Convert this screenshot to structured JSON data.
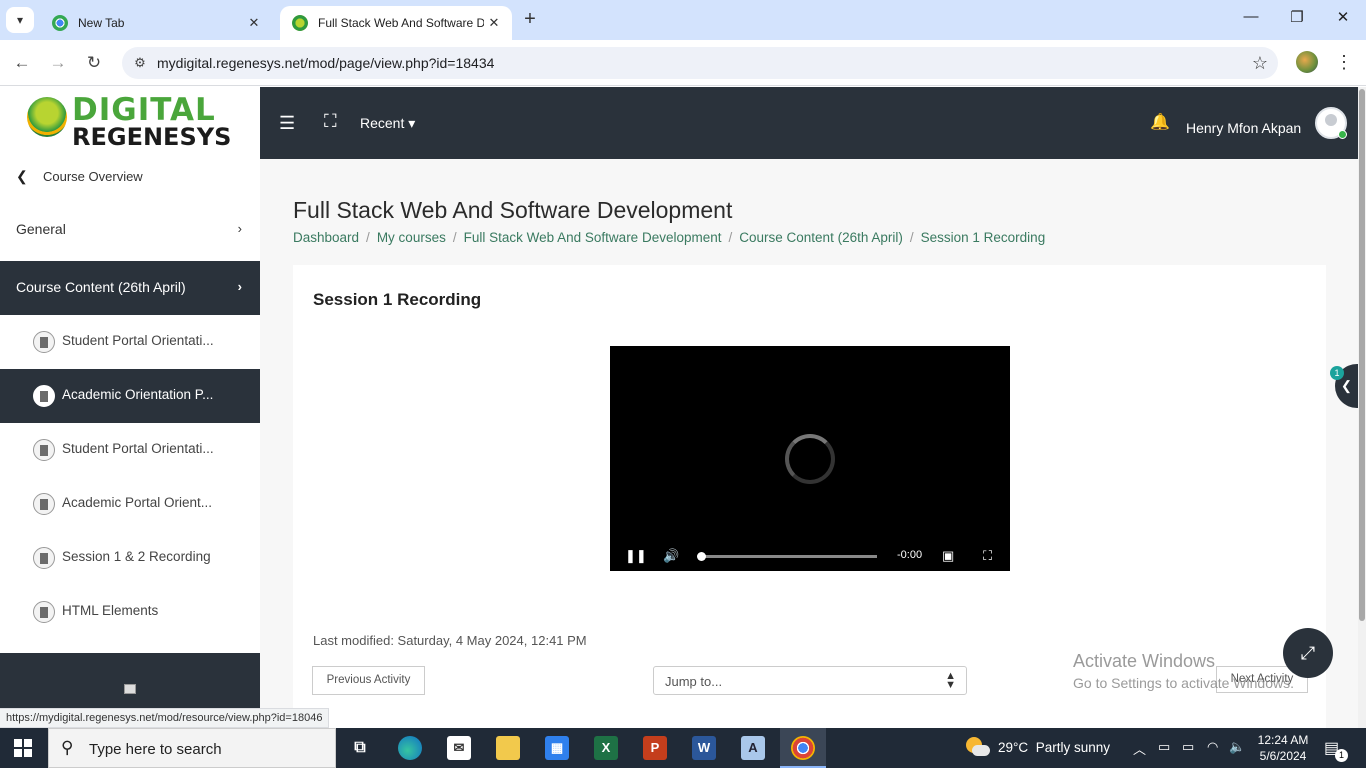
{
  "browser": {
    "tabs": [
      {
        "title": "New Tab",
        "active": false
      },
      {
        "title": "Full Stack Web And Software De",
        "active": true
      }
    ],
    "url": "mydigital.regenesys.net/mod/page/view.php?id=18434",
    "status_link": "https://mydigital.regenesys.net/mod/resource/view.php?id=18046"
  },
  "brand": {
    "logo_line1": "DIGITAL",
    "logo_line2": "REGENESYS",
    "accent": "#4aa63b",
    "nav_bg": "#2a323b"
  },
  "header": {
    "recent_label": "Recent",
    "user_name": "Henry Mfon Akpan"
  },
  "sidebar": {
    "back_label": "Course Overview",
    "sections": [
      {
        "label": "General"
      },
      {
        "label": "Course Content (26th April)"
      }
    ],
    "items": [
      {
        "label": "Student Portal Orientati...",
        "icon": "document-icon",
        "active": false
      },
      {
        "label": "Academic Orientation P...",
        "icon": "document-icon",
        "active": true
      },
      {
        "label": "Student Portal Orientati...",
        "icon": "document-icon",
        "active": false
      },
      {
        "label": "Academic Portal Orient...",
        "icon": "document-icon",
        "active": false
      },
      {
        "label": "Session 1 & 2 Recording",
        "icon": "document-icon",
        "active": false
      },
      {
        "label": "HTML Elements",
        "icon": "book-icon",
        "active": false
      }
    ]
  },
  "main": {
    "page_title": "Full Stack Web And Software Development",
    "breadcrumb": [
      "Dashboard",
      "My courses",
      "Full Stack Web And Software Development",
      "Course Content (26th April)",
      "Session 1 Recording"
    ],
    "card_title": "Session 1 Recording",
    "video": {
      "time": "-0:00",
      "progress": 0
    },
    "last_modified": "Last modified: Saturday, 4 May 2024, 12:41 PM",
    "prev_label": "Previous Activity",
    "jump_label": "Jump to...",
    "next_label": "Next Activity",
    "drawer_badge": "1"
  },
  "watermark": {
    "line1": "Activate Windows",
    "line2": "Go to Settings to activate Windows."
  },
  "taskbar": {
    "search_placeholder": "Type here to search",
    "temperature": "29°C",
    "weather": "Partly sunny",
    "time": "12:24 AM",
    "date": "5/6/2024",
    "notifications": "1"
  }
}
